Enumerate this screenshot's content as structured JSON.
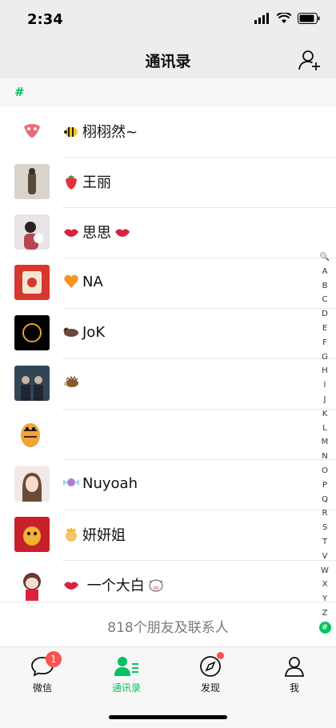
{
  "status": {
    "time": "2:34"
  },
  "header": {
    "title": "通讯录",
    "add_icon": "add-friend-icon"
  },
  "section": {
    "letter": "#"
  },
  "contacts": [
    {
      "name": "栩栩然~",
      "emoji": "bee"
    },
    {
      "name": "王丽",
      "emoji": "strawberry"
    },
    {
      "name": "思思",
      "emoji": "lips"
    },
    {
      "name": "NA",
      "emoji": "heart"
    },
    {
      "name": "JoK",
      "emoji": "otter"
    },
    {
      "name": "",
      "emoji": "hedgehog"
    },
    {
      "name": "",
      "emoji": ""
    },
    {
      "name": "Nuyoah",
      "emoji": "candy"
    },
    {
      "name": "妍妍姐",
      "emoji": "princess"
    },
    {
      "name": "一个大白",
      "emoji": "lips"
    }
  ],
  "footer": {
    "count_text": "818个朋友及联系人"
  },
  "index": [
    "🔍",
    "A",
    "B",
    "C",
    "D",
    "E",
    "F",
    "G",
    "H",
    "I",
    "J",
    "K",
    "L",
    "M",
    "N",
    "O",
    "P",
    "Q",
    "R",
    "S",
    "T",
    "V",
    "W",
    "X",
    "Y",
    "Z",
    "#"
  ],
  "tabs": [
    {
      "label": "微信",
      "badge": "1"
    },
    {
      "label": "通讯录"
    },
    {
      "label": "发现",
      "dot": true
    },
    {
      "label": "我"
    }
  ],
  "colors": {
    "accent": "#07c160",
    "badge": "#fa5151"
  }
}
